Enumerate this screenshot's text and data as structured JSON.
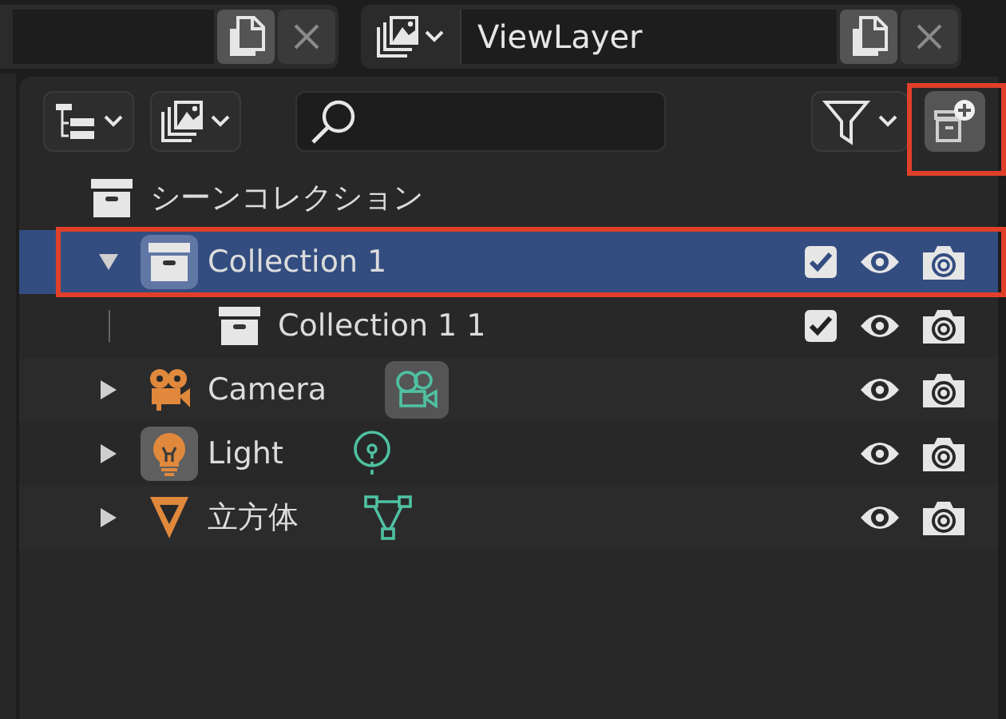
{
  "header": {
    "scene_field": {
      "kind": "field"
    },
    "view_layer": {
      "name": "ViewLayer"
    }
  },
  "toolbar": {
    "new_collection_button": {
      "highlighted": true
    }
  },
  "outliner": {
    "name": "シーンコレクション",
    "kind": "scene",
    "children": [
      {
        "name": "Collection 1",
        "kind": "collection",
        "expanded": true,
        "selected": true,
        "highlighted": true,
        "icon_active": true,
        "checked": true,
        "visible": true,
        "renderable": true,
        "children": [
          {
            "name": "Collection 1 1",
            "kind": "collection",
            "selected": false,
            "checked": true,
            "visible": true,
            "renderable": true
          }
        ]
      },
      {
        "name": "Camera",
        "kind": "camera",
        "expanded": false,
        "selected": false,
        "icon_active": false,
        "data_active": true,
        "visible": true,
        "renderable": true
      },
      {
        "name": "Light",
        "kind": "light",
        "expanded": false,
        "selected": false,
        "icon_active": true,
        "data_active": false,
        "visible": true,
        "renderable": true
      },
      {
        "name": "立方体",
        "kind": "mesh",
        "expanded": false,
        "selected": false,
        "icon_active": false,
        "data_active": false,
        "visible": true,
        "renderable": true
      }
    ]
  }
}
